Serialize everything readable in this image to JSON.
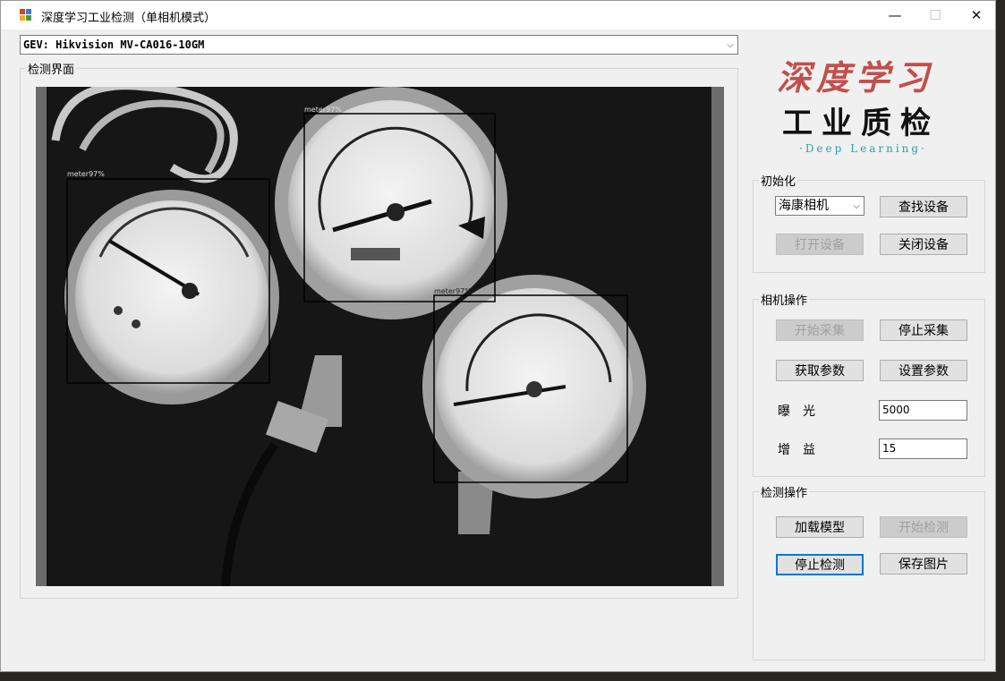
{
  "window": {
    "title": "深度学习工业检测（单相机模式）",
    "controls": {
      "minimize": "—",
      "maximize": "☐",
      "close": "✕"
    }
  },
  "device_combo": {
    "value": "GEV: Hikvision MV-CA016-10GM"
  },
  "detection_panel": {
    "label": "检测界面",
    "detections": [
      {
        "label": "meter97%"
      },
      {
        "label": "meter97%"
      },
      {
        "label": "meter97%"
      }
    ]
  },
  "logo": {
    "line1": "深度学习",
    "line2": "工业质检",
    "line3": "·Deep Learning·"
  },
  "init_group": {
    "label": "初始化",
    "camera_select": "海康相机",
    "find_device": "查找设备",
    "open_device": "打开设备",
    "close_device": "关闭设备"
  },
  "camera_group": {
    "label": "相机操作",
    "start_grab": "开始采集",
    "stop_grab": "停止采集",
    "get_params": "获取参数",
    "set_params": "设置参数",
    "exposure_label": "曝　光",
    "exposure_value": "5000",
    "gain_label": "增　益",
    "gain_value": "15"
  },
  "detect_group": {
    "label": "检测操作",
    "load_model": "加载模型",
    "start_detect": "开始检测",
    "stop_detect": "停止检测",
    "save_image": "保存图片"
  },
  "colors": {
    "accent": "#0078d7",
    "logo_red": "#c0504d",
    "logo_teal": "#2aa3a3"
  }
}
